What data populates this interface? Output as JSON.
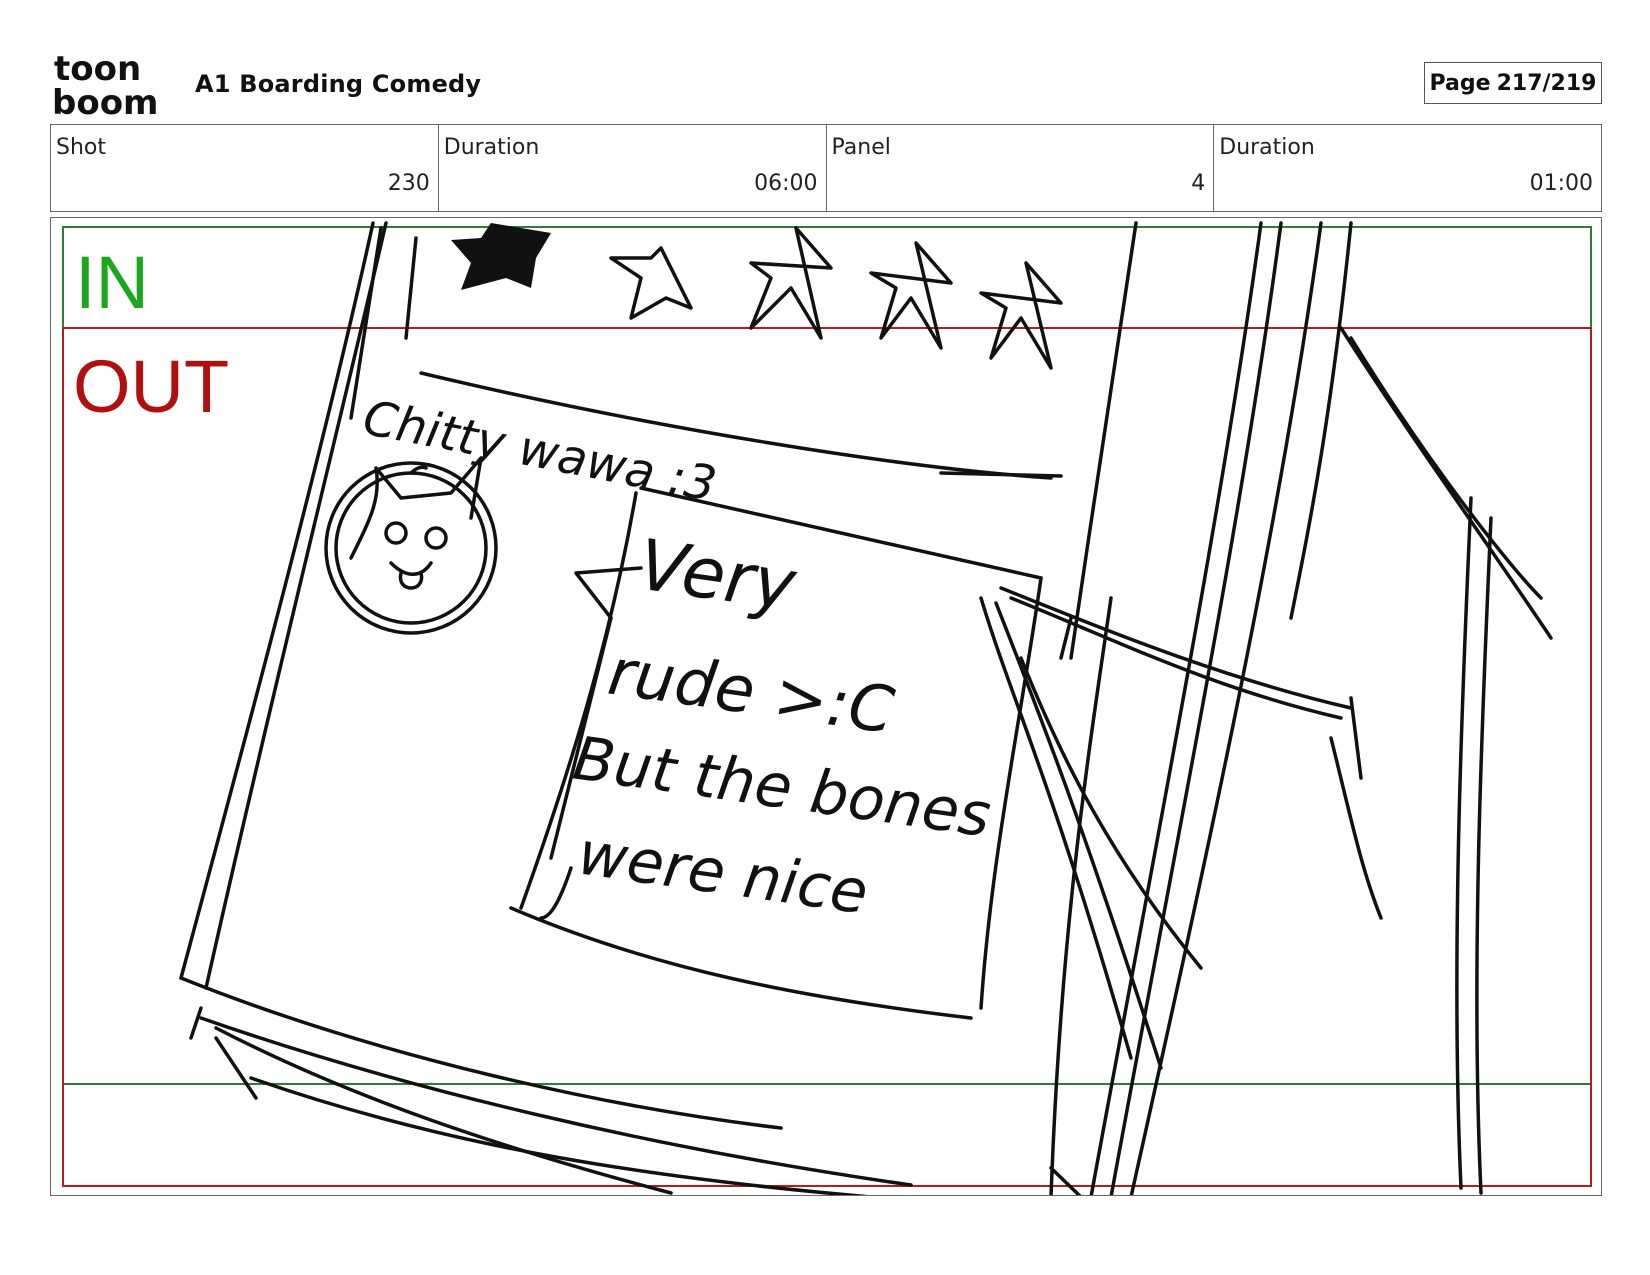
{
  "header": {
    "logo_top": "toon",
    "logo_bottom": "boom",
    "project_title": "A1 Boarding Comedy",
    "page_label": "Page",
    "page_value": "217/219"
  },
  "info": [
    {
      "label": "Shot",
      "value": "230"
    },
    {
      "label": "Duration",
      "value": "06:00"
    },
    {
      "label": "Panel",
      "value": "4"
    },
    {
      "label": "Duration",
      "value": "01:00"
    }
  ],
  "panel": {
    "in_label": "IN",
    "out_label": "OUT",
    "colors": {
      "in": "#1aa81a",
      "out": "#b01010",
      "in_frame": "#2e7d32",
      "out_frame": "#b71c1c"
    },
    "sketch": {
      "username": "Chitty wawa :3",
      "rating_stars": 5,
      "rating_filled": 1,
      "review_lines": [
        "Very",
        "rude >:C",
        "But the bones",
        "were nice"
      ]
    }
  }
}
